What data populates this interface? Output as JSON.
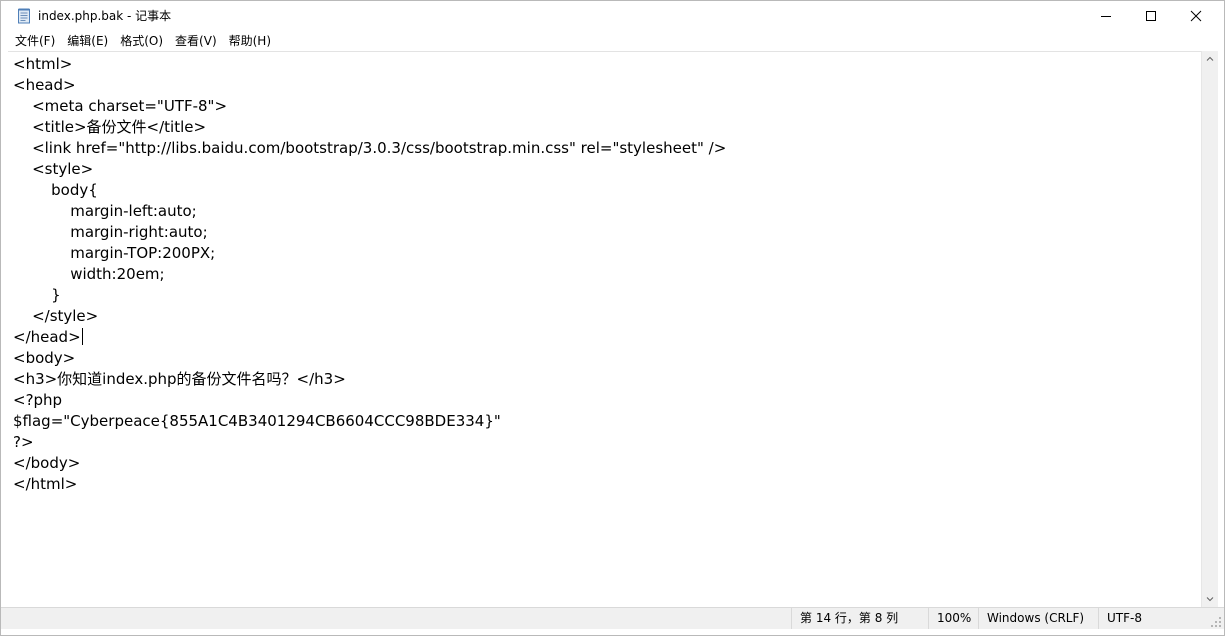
{
  "window": {
    "title": "index.php.bak - 记事本",
    "app_icon": "notepad-icon",
    "controls": {
      "minimize_icon": "minimize-icon",
      "maximize_icon": "maximize-icon",
      "close_icon": "close-icon"
    }
  },
  "menu": {
    "items": [
      {
        "label": "文件(F)"
      },
      {
        "label": "编辑(E)"
      },
      {
        "label": "格式(O)"
      },
      {
        "label": "查看(V)"
      },
      {
        "label": "帮助(H)"
      }
    ]
  },
  "editor": {
    "lines": [
      "<html>",
      "<head>",
      "    <meta charset=\"UTF-8\">",
      "    <title>备份文件</title>",
      "    <link href=\"http://libs.baidu.com/bootstrap/3.0.3/css/bootstrap.min.css\" rel=\"stylesheet\" />",
      "    <style>",
      "        body{",
      "            margin-left:auto;",
      "            margin-right:auto;",
      "            margin-TOP:200PX;",
      "            width:20em;",
      "        }",
      "    </style>",
      "</head>",
      "<body>",
      "<h3>你知道index.php的备份文件名吗？</h3>",
      "<?php",
      "$flag=\"Cyberpeace{855A1C4B3401294CB6604CCC98BDE334}\"",
      "?>",
      "</body>",
      "</html>"
    ],
    "caret_line_index": 13
  },
  "status": {
    "position": "第 14 行，第 8 列",
    "zoom": "100%",
    "line_ending": "Windows (CRLF)",
    "encoding": "UTF-8"
  },
  "colors": {
    "background": "#ffffff",
    "statusbar_bg": "#f0f0f0",
    "text": "#000000"
  }
}
